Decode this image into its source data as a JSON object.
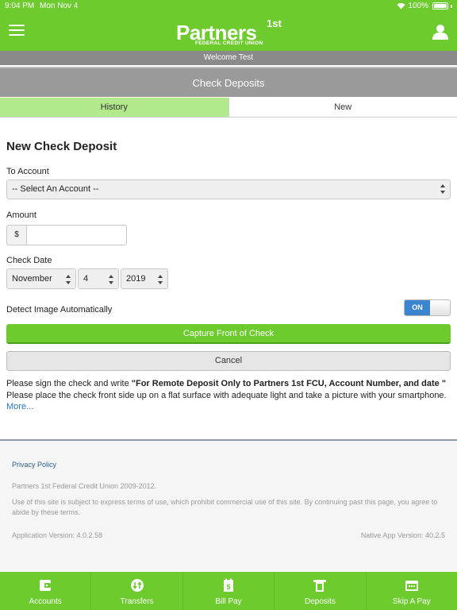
{
  "status_bar": {
    "time": "9:04 PM",
    "date": "Mon Nov 4",
    "battery": "100%"
  },
  "header": {
    "logo_name": "Partners",
    "logo_sup": "1st",
    "logo_subtitle": "FEDERAL CREDIT UNION"
  },
  "welcome": "Welcome Test",
  "page_title": "Check Deposits",
  "tabs": [
    {
      "label": "History"
    },
    {
      "label": "New"
    }
  ],
  "form": {
    "title": "New Check Deposit",
    "to_account_label": "To Account",
    "to_account_value": "-- Select An Account --",
    "amount_label": "Amount",
    "currency_symbol": "$",
    "amount_value": "",
    "check_date_label": "Check Date",
    "month": "November",
    "day": "4",
    "year": "2019",
    "detect_label": "Detect Image Automatically",
    "detect_state": "ON",
    "capture_button": "Capture Front of Check",
    "cancel_button": "Cancel"
  },
  "instructions": {
    "line1_prefix": "Please sign the check and write ",
    "line1_bold": "\"For Remote Deposit Only to Partners 1st FCU, Account Number, and date \"",
    "line2": "Please place the check front side up on a flat surface with adequate light and take a picture with your smartphone.",
    "more": "More..."
  },
  "footer": {
    "privacy": "Privacy Policy",
    "copyright": "Partners 1st Federal Credit Union 2009-2012.",
    "terms": "Use of this site is subject to express terms of use, which prohibit commercial use of this site. By continuing past this page, you agree to abide by these terms.",
    "app_version": "Application Version: 4.0.2.58",
    "native_version": "Native App Version: 40.2.5"
  },
  "bottom_nav": [
    {
      "label": "Accounts",
      "icon": "wallet-icon"
    },
    {
      "label": "Transfers",
      "icon": "transfer-icon"
    },
    {
      "label": "Bill Pay",
      "icon": "bill-icon"
    },
    {
      "label": "Deposits",
      "icon": "deposit-icon"
    },
    {
      "label": "Skip A Pay",
      "icon": "calendar-icon"
    }
  ],
  "colors": {
    "brand_green": "#6dcb2e",
    "tab_history": "#b1e98c",
    "toggle_on": "#3b84d0",
    "link": "#2b74c4"
  }
}
